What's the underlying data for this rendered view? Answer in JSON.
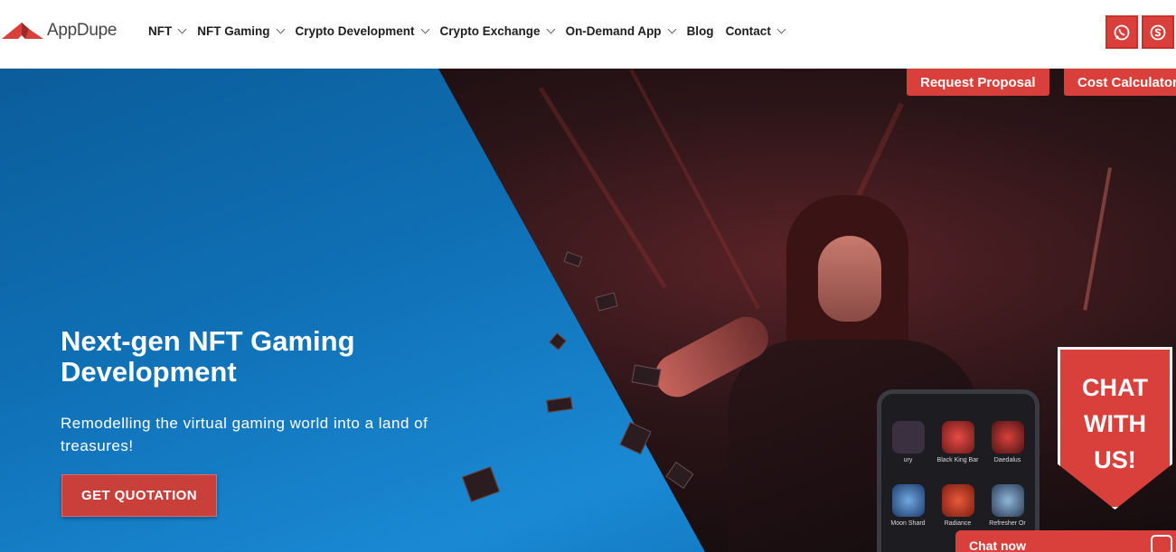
{
  "brand": {
    "name": "AppDupe",
    "accent": "#d9403b",
    "hero_blue": "#0f6fb4"
  },
  "nav": {
    "items": [
      {
        "label": "NFT",
        "dropdown": true
      },
      {
        "label": "NFT Gaming",
        "dropdown": true
      },
      {
        "label": "Crypto Development",
        "dropdown": true
      },
      {
        "label": "Crypto Exchange",
        "dropdown": true
      },
      {
        "label": "On-Demand App",
        "dropdown": true
      },
      {
        "label": "Blog",
        "dropdown": false
      },
      {
        "label": "Contact",
        "dropdown": true
      }
    ],
    "social": [
      {
        "icon": "whatsapp-icon"
      },
      {
        "icon": "skype-icon"
      }
    ]
  },
  "quick_actions": {
    "request_proposal": "Request Proposal",
    "cost_calculator": "Cost Calculator"
  },
  "hero": {
    "title": "Next-gen NFT Gaming Development",
    "subtitle": "Remodelling the virtual gaming world into a land of treasures!",
    "cta": "GET QUOTATION"
  },
  "phone_items": [
    "ury",
    "Black King Bar",
    "Daedalus",
    "Moon Shard",
    "Radiance",
    "Refresher Or"
  ],
  "chat": {
    "badge": "CHAT WITH US!",
    "bar_label": "Chat now"
  }
}
